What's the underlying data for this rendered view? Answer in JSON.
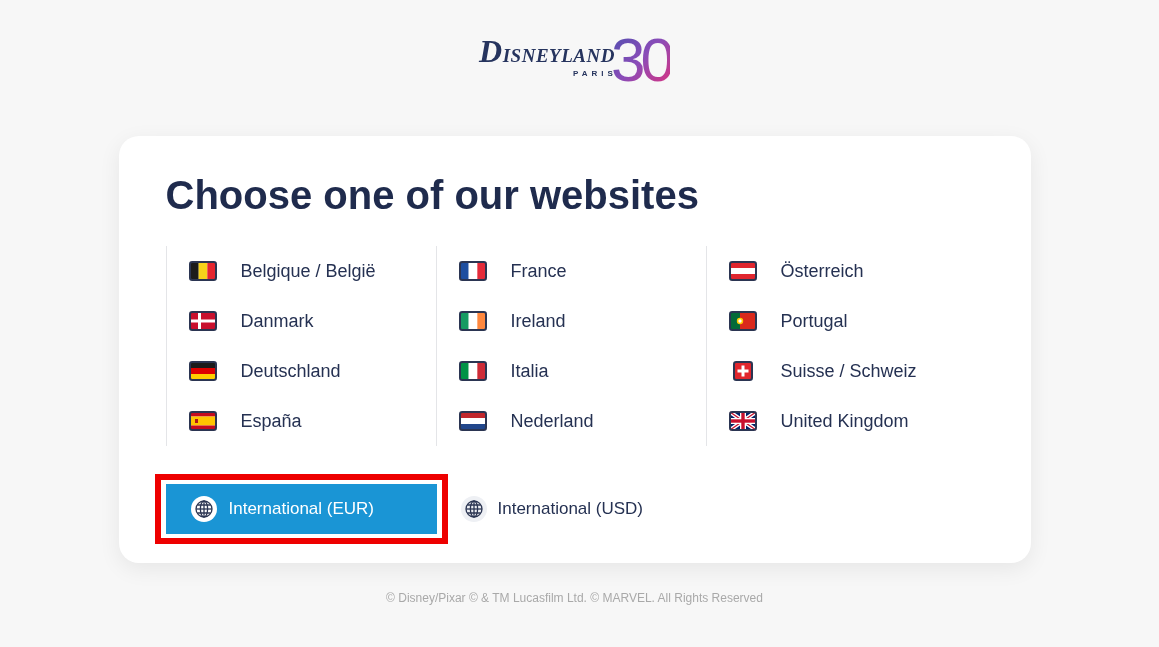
{
  "logo": {
    "wordmark": "DISNEYLAND",
    "subtitle": "PARIS",
    "anniversary": "30"
  },
  "card": {
    "title": "Choose one of our websites",
    "columns": [
      {
        "sites": [
          {
            "label": "Belgique / België",
            "kind": "belgium"
          },
          {
            "label": "Danmark",
            "kind": "denmark"
          },
          {
            "label": "Deutschland",
            "kind": "germany"
          },
          {
            "label": "España",
            "kind": "spain"
          }
        ]
      },
      {
        "sites": [
          {
            "label": "France",
            "kind": "france"
          },
          {
            "label": "Ireland",
            "kind": "ireland"
          },
          {
            "label": "Italia",
            "kind": "italy"
          },
          {
            "label": "Nederland",
            "kind": "netherlands"
          }
        ]
      },
      {
        "sites": [
          {
            "label": "Österreich",
            "kind": "austria"
          },
          {
            "label": "Portugal",
            "kind": "portugal"
          },
          {
            "label": "Suisse / Schweiz",
            "kind": "switzerland"
          },
          {
            "label": "United Kingdom",
            "kind": "uk"
          }
        ]
      }
    ],
    "international": [
      {
        "label": "International (EUR)",
        "selected": true,
        "highlighted": true
      },
      {
        "label": "International (USD)",
        "selected": false,
        "highlighted": false
      }
    ]
  },
  "footer": "© Disney/Pixar © & TM Lucasfilm Ltd. © MARVEL. All Rights Reserved"
}
